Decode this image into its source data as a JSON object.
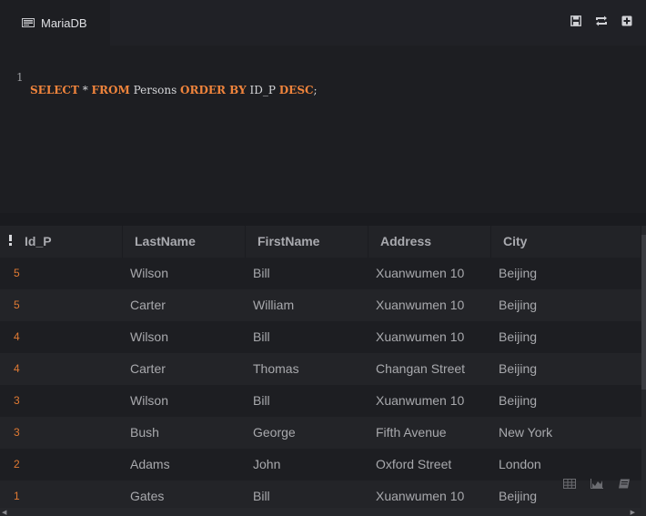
{
  "tab": {
    "label": "MariaDB",
    "icon": "database-icon"
  },
  "toolbar": {
    "icons": [
      "save-icon",
      "refresh-icon",
      "add-icon"
    ]
  },
  "editor": {
    "line_number": "1",
    "tokens": [
      {
        "t": "SELECT",
        "kw": true
      },
      {
        "t": " * ",
        "kw": false
      },
      {
        "t": "FROM",
        "kw": true
      },
      {
        "t": " Persons ",
        "kw": false
      },
      {
        "t": "ORDER BY",
        "kw": true
      },
      {
        "t": " ID_P ",
        "kw": false
      },
      {
        "t": "DESC",
        "kw": true
      },
      {
        "t": ";",
        "kw": false
      }
    ]
  },
  "table": {
    "columns": [
      "Id_P",
      "LastName",
      "FirstName",
      "Address",
      "City"
    ],
    "rows": [
      [
        "5",
        "Wilson",
        "Bill",
        "Xuanwumen 10",
        "Beijing"
      ],
      [
        "5",
        "Carter",
        "William",
        "Xuanwumen 10",
        "Beijing"
      ],
      [
        "4",
        "Wilson",
        "Bill",
        "Xuanwumen 10",
        "Beijing"
      ],
      [
        "4",
        "Carter",
        "Thomas",
        "Changan Street",
        "Beijing"
      ],
      [
        "3",
        "Wilson",
        "Bill",
        "Xuanwumen 10",
        "Beijing"
      ],
      [
        "3",
        "Bush",
        "George",
        "Fifth Avenue",
        "New York"
      ],
      [
        "2",
        "Adams",
        "John",
        "Oxford Street",
        "London"
      ],
      [
        "1",
        "Gates",
        "Bill",
        "Xuanwumen 10",
        "Beijing"
      ]
    ]
  },
  "view_switch": {
    "icons": [
      "table-view-icon",
      "chart-view-icon",
      "export-icon"
    ]
  },
  "colors": {
    "keyword": "#f0843c",
    "id_value": "#e07a33",
    "background": "#1d1e22"
  }
}
